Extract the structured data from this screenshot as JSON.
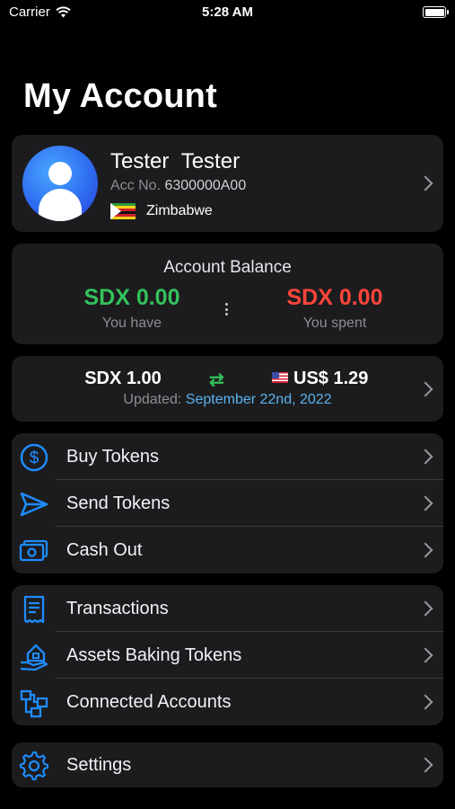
{
  "status_bar": {
    "carrier": "Carrier",
    "time": "5:28 AM"
  },
  "title": "My Account",
  "profile": {
    "first_name": "Tester",
    "last_name": "Tester",
    "acc_label": "Acc No.",
    "acc_number": "6300000A00",
    "country": "Zimbabwe"
  },
  "balance": {
    "title": "Account Balance",
    "have_value": "SDX 0.00",
    "have_label": "You have",
    "spent_value": "SDX 0.00",
    "spent_label": "You spent"
  },
  "rate": {
    "from": "SDX 1.00",
    "swap_symbol": "⇄",
    "to": "US$ 1.29",
    "updated_label": "Updated:",
    "updated_date": "September 22nd, 2022"
  },
  "menu_group_1": [
    {
      "label": "Buy Tokens",
      "icon": "dollar-circle-icon"
    },
    {
      "label": "Send Tokens",
      "icon": "paper-plane-icon"
    },
    {
      "label": "Cash Out",
      "icon": "cash-icon"
    }
  ],
  "menu_group_2": [
    {
      "label": "Transactions",
      "icon": "receipt-icon"
    },
    {
      "label": "Assets Baking Tokens",
      "icon": "house-hand-icon"
    },
    {
      "label": "Connected Accounts",
      "icon": "network-icon"
    }
  ],
  "menu_group_3": [
    {
      "label": "Settings",
      "icon": "gear-icon"
    }
  ],
  "colors": {
    "background": "#000000",
    "card": "#1c1c1e",
    "positive": "#33c15b",
    "negative": "#ff453a",
    "link": "#5ab3ee",
    "icon": "#1f8cff"
  }
}
